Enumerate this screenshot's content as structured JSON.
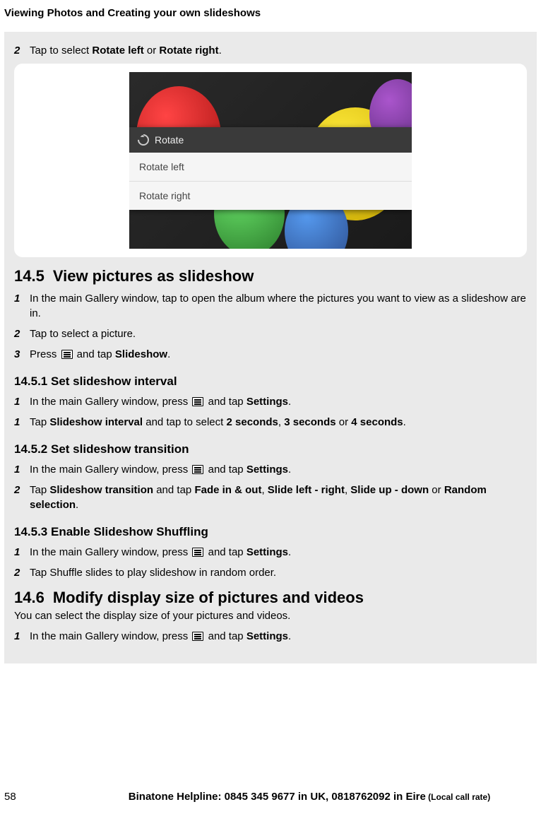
{
  "header": {
    "title": "Viewing Photos and Creating your own slideshows"
  },
  "topStep": {
    "number": "2",
    "prefix": "Tap to select ",
    "bold1": "Rotate left",
    "mid": " or ",
    "bold2": "Rotate right",
    "suffix": "."
  },
  "rotateDialog": {
    "title": "Rotate",
    "option1": "Rotate left",
    "option2": "Rotate right"
  },
  "section145": {
    "number": "14.5",
    "title": "View pictures as slideshow",
    "step1": {
      "num": "1",
      "text": "In the main Gallery window, tap to open the album where the pictures you want to view as a slideshow are in."
    },
    "step2": {
      "num": "2",
      "text": "Tap to select a picture."
    },
    "step3": {
      "num": "3",
      "prefix": "Press ",
      "mid": " and tap ",
      "bold": "Slideshow",
      "suffix": "."
    }
  },
  "section1451": {
    "title": "14.5.1 Set slideshow interval",
    "step1": {
      "num": "1",
      "prefix": "In the main Gallery window, press ",
      "mid": " and tap ",
      "bold": "Settings",
      "suffix": "."
    },
    "step2": {
      "num": "1",
      "prefix": "Tap ",
      "bold1": "Slideshow interval",
      "mid1": " and tap to select ",
      "bold2": "2 seconds",
      "mid2": ", ",
      "bold3": "3 seconds",
      "mid3": " or ",
      "bold4": "4 seconds",
      "suffix": "."
    }
  },
  "section1452": {
    "title": "14.5.2 Set slideshow transition",
    "step1": {
      "num": "1",
      "prefix": "In the main Gallery window, press ",
      "mid": " and tap ",
      "bold": "Settings",
      "suffix": "."
    },
    "step2": {
      "num": "2",
      "prefix": "Tap ",
      "bold1": "Slideshow transition",
      "mid1": " and tap ",
      "bold2": "Fade in & out",
      "mid2": ", ",
      "bold3": "Slide left - right",
      "mid3": ", ",
      "bold4": "Slide up - down",
      "mid4": " or ",
      "bold5": "Random selection",
      "suffix": "."
    }
  },
  "section1453": {
    "title": "14.5.3 Enable Slideshow Shuffling",
    "step1": {
      "num": "1",
      "prefix": "In the main Gallery window, press ",
      "mid": " and tap ",
      "bold": "Settings",
      "suffix": "."
    },
    "step2": {
      "num": "2",
      "text": "Tap Shuffle slides to play slideshow in random order."
    }
  },
  "section146": {
    "number": "14.6",
    "title": "Modify display size of pictures and videos",
    "intro": "You can select the display size of your pictures and videos.",
    "step1": {
      "num": "1",
      "prefix": "In the main Gallery window, press ",
      "mid": " and tap ",
      "bold": "Settings",
      "suffix": "."
    }
  },
  "footer": {
    "pageNumber": "58",
    "helpline": "Binatone Helpline: 0845 345 9677 in UK, 0818762092 in Eire",
    "rate": " (Local call rate)"
  }
}
